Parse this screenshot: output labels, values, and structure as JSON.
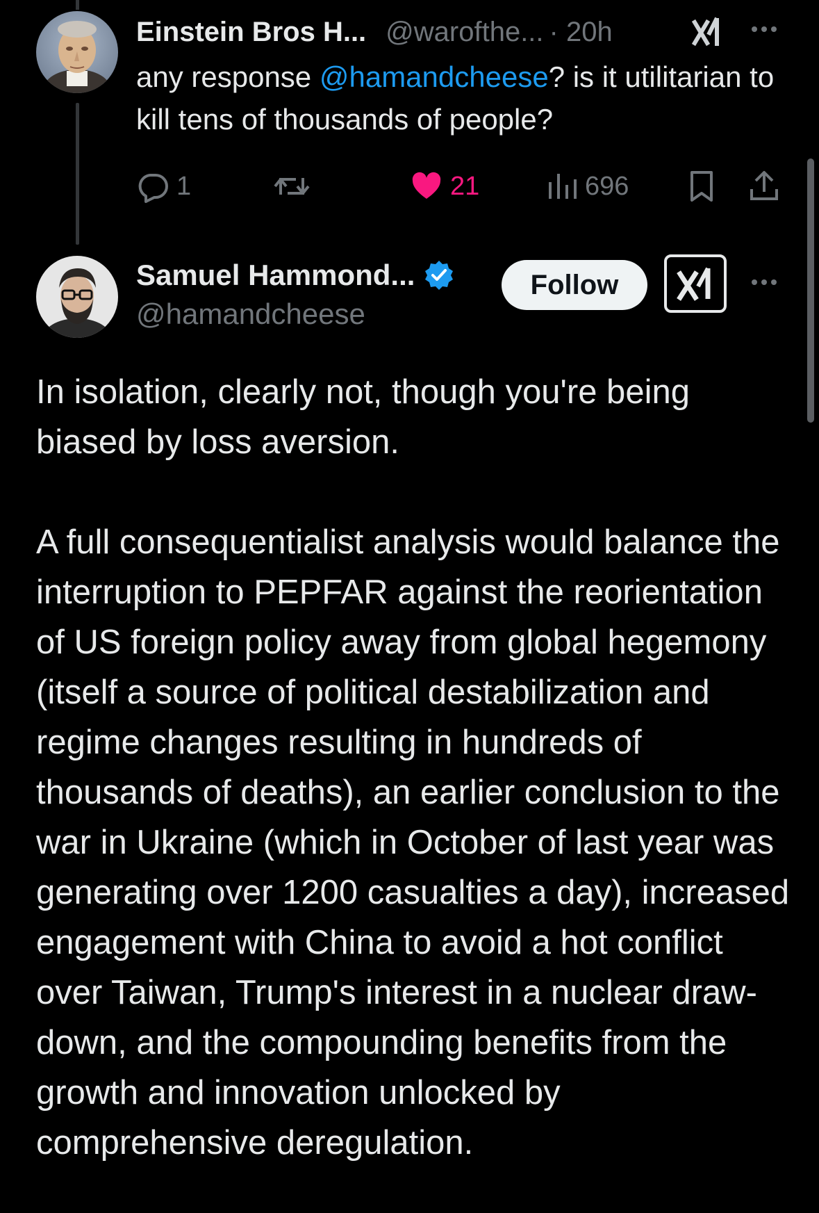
{
  "reply": {
    "author_name": "Einstein Bros H...",
    "author_handle": "@warofthe...",
    "time": "· 20h",
    "text_before": "any response ",
    "mention": "@hamandcheese",
    "text_after": "? is it utilitarian to kill tens of thousands of people?",
    "replies": "1",
    "likes": "21",
    "views": "696"
  },
  "main_post": {
    "author_name": "Samuel Hammond...",
    "author_handle": "@hamandcheese",
    "follow_label": "Follow",
    "paragraphs": [
      "In isolation, clearly not, though you're being biased by loss aversion.",
      "A full consequentialist analysis would balance the interruption to PEPFAR against the reorientation of US foreign policy away from global hegemony (itself a source of political destabilization and regime changes resulting in hundreds of thousands of deaths), an earlier conclusion to the war in Ukraine (which in October of last year was generating over 1200 casualties a day), increased engagement with China to avoid a hot conflict over Taiwan, Trump's interest in a nuclear draw-down, and the compounding benefits from the growth and innovation unlocked by comprehensive deregulation."
    ]
  },
  "icons": {
    "reply": "speech-bubble-icon",
    "retweet": "repost-icon",
    "like": "heart-icon",
    "views": "bar-chart-icon",
    "bookmark": "bookmark-icon",
    "share": "share-icon",
    "grok": "grok-icon",
    "more": "ellipsis-icon",
    "verified": "verified-badge-icon"
  },
  "colors": {
    "background": "#000000",
    "text": "#e7e9ea",
    "secondary": "#71767b",
    "link": "#1d9bf0",
    "like": "#f91880",
    "verified": "#1d9bf0"
  }
}
